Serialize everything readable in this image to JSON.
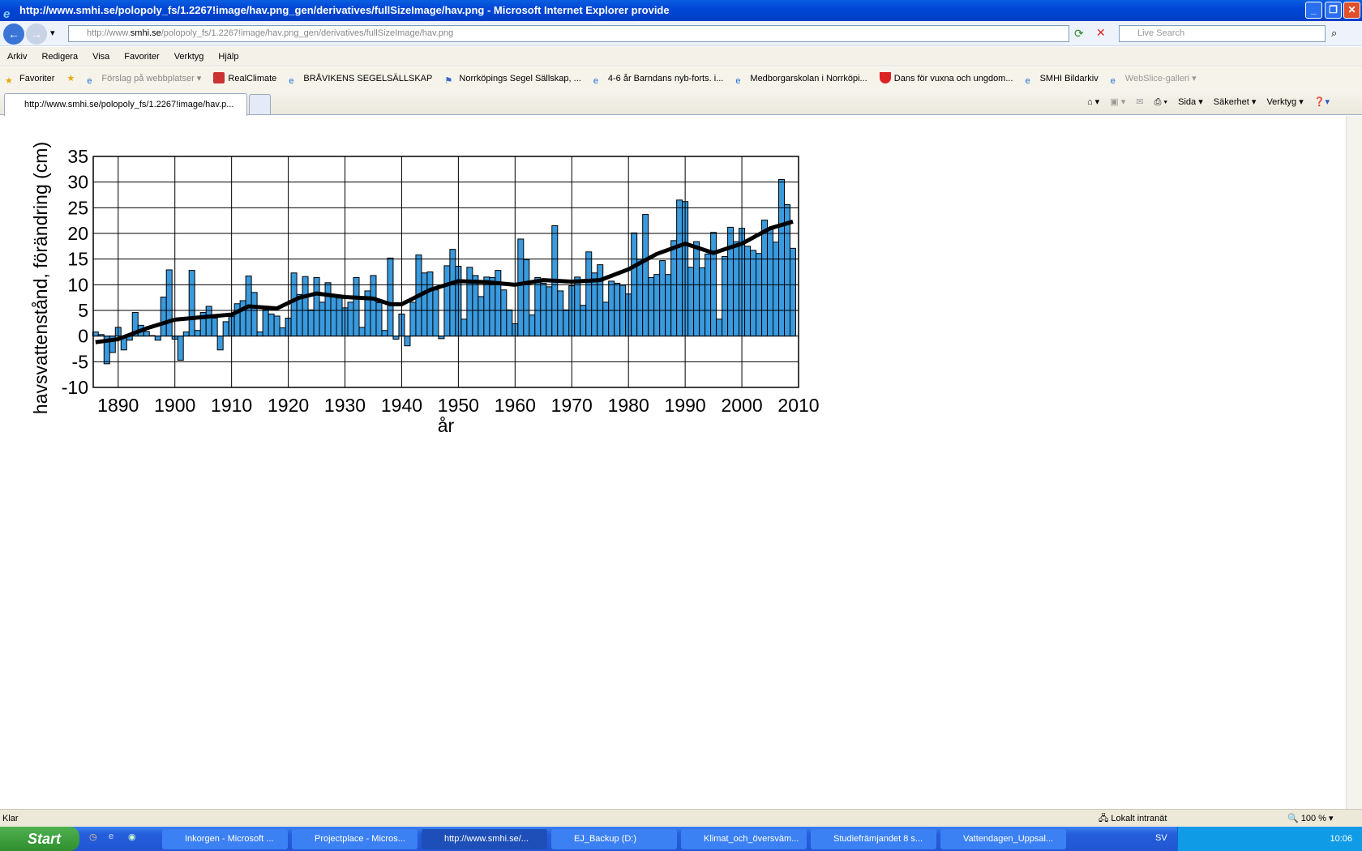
{
  "window": {
    "title": "http://www.smhi.se/polopoly_fs/1.2267!image/hav.png_gen/derivatives/fullSizeImage/hav.png - Microsoft Internet Explorer provide"
  },
  "address": {
    "prefix": "http://www.",
    "host": "smhi.se",
    "path": "/polopoly_fs/1.2267!image/hav.png_gen/derivatives/fullSizeImage/hav.png",
    "search_placeholder": "Live Search"
  },
  "menu": [
    "Arkiv",
    "Redigera",
    "Visa",
    "Favoriter",
    "Verktyg",
    "Hjälp"
  ],
  "favorites": {
    "label": "Favoriter",
    "items": [
      "Förslag på webbplatser",
      "RealClimate",
      "BRÅVIKENS SEGELSÄLLSKAP",
      "Norrköpings Segel Sällskap, ...",
      "4-6 år Barndans nyb-forts. i...",
      "Medborgarskolan i Norrköpi...",
      "Dans för vuxna och ungdom...",
      "SMHI Bildarkiv",
      "WebSlice-galleri"
    ]
  },
  "tab": {
    "label": "http://www.smhi.se/polopoly_fs/1.2267!image/hav.p..."
  },
  "commands": [
    "Sida ▾",
    "Säkerhet ▾",
    "Verktyg ▾"
  ],
  "status": {
    "text": "Klar",
    "zone": "Lokalt intranät",
    "zoom": "100 %"
  },
  "taskbar": {
    "start": "Start",
    "tasks": [
      "Inkorgen - Microsoft ...",
      "Projectplace - Micros...",
      "http://www.smhi.se/...",
      "EJ_Backup (D:)",
      "Klimat_och_översväm...",
      "Studiefrämjandet 8 s...",
      "Vattendagen_Uppsal..."
    ],
    "active": 2,
    "lang": "SV",
    "clock": "10:06"
  },
  "colors": {
    "bar": "#3a9ade",
    "line": "#000000",
    "titlebar": "#0046d5"
  },
  "chart_data": {
    "type": "bar",
    "xlabel": "år",
    "ylabel": "havsvattenstånd, förändring (cm)",
    "xlim": [
      1885.6,
      2010
    ],
    "ylim": [
      -10,
      35
    ],
    "grid": true,
    "xticks": [
      1890,
      1900,
      1910,
      1920,
      1930,
      1940,
      1950,
      1960,
      1970,
      1980,
      1990,
      2000,
      2010
    ],
    "yticks": [
      -10,
      -5,
      0,
      5,
      10,
      15,
      20,
      25,
      30,
      35
    ],
    "years_start": 1886,
    "values": [
      0.8,
      0.3,
      -5.4,
      -3.2,
      1.7,
      -2.7,
      -0.8,
      4.6,
      2.1,
      0.9,
      0.1,
      -0.8,
      7.6,
      12.9,
      -0.6,
      -4.7,
      0.8,
      12.8,
      1.1,
      4.6,
      5.8,
      3.5,
      -2.7,
      2.8,
      3.8,
      6.3,
      6.9,
      11.7,
      8.5,
      0.8,
      5.1,
      4.3,
      3.9,
      1.6,
      3.5,
      12.3,
      8.1,
      11.6,
      5.1,
      11.4,
      6.6,
      10.4,
      7.6,
      7.4,
      5.5,
      6.6,
      11.4,
      1.7,
      8.8,
      11.8,
      6.5,
      1.1,
      15.2,
      -0.6,
      4.3,
      -1.9,
      6.6,
      15.8,
      12.3,
      12.5,
      9.0,
      -0.5,
      13.7,
      16.9,
      13.6,
      3.3,
      13.4,
      11.8,
      7.7,
      11.5,
      11.4,
      12.8,
      9.0,
      5.1,
      2.4,
      18.9,
      14.9,
      4.1,
      11.4,
      10.3,
      9.6,
      21.5,
      8.8,
      5.1,
      9.8,
      11.5,
      6.0,
      16.4,
      12.3,
      13.9,
      6.6,
      10.7,
      10.3,
      9.9,
      8.2,
      20.1,
      15.0,
      23.7,
      11.4,
      12.0,
      14.7,
      12.0,
      18.6,
      26.5,
      26.2,
      13.4,
      18.4,
      13.3,
      16.0,
      20.2,
      3.3,
      15.5,
      21.2,
      18.4,
      21.0,
      17.5,
      16.7,
      16.1,
      22.6,
      20.9,
      18.3,
      30.5,
      25.6,
      17.1
    ],
    "smooth": {
      "x": [
        1886,
        1890,
        1895,
        1900,
        1905,
        1910,
        1913,
        1918,
        1922,
        1925,
        1930,
        1935,
        1938,
        1940,
        1945,
        1950,
        1955,
        1960,
        1965,
        1970,
        1975,
        1980,
        1985,
        1990,
        1995,
        2000,
        2005,
        2009
      ],
      "y": [
        -1.2,
        -0.6,
        1.5,
        3.2,
        3.7,
        4.2,
        5.8,
        5.4,
        7.5,
        8.3,
        7.6,
        7.3,
        6.2,
        6.2,
        9.0,
        10.7,
        10.5,
        10.0,
        10.9,
        10.6,
        10.9,
        13.0,
        16.0,
        18.0,
        16.2,
        18.0,
        21.0,
        22.3
      ]
    }
  }
}
